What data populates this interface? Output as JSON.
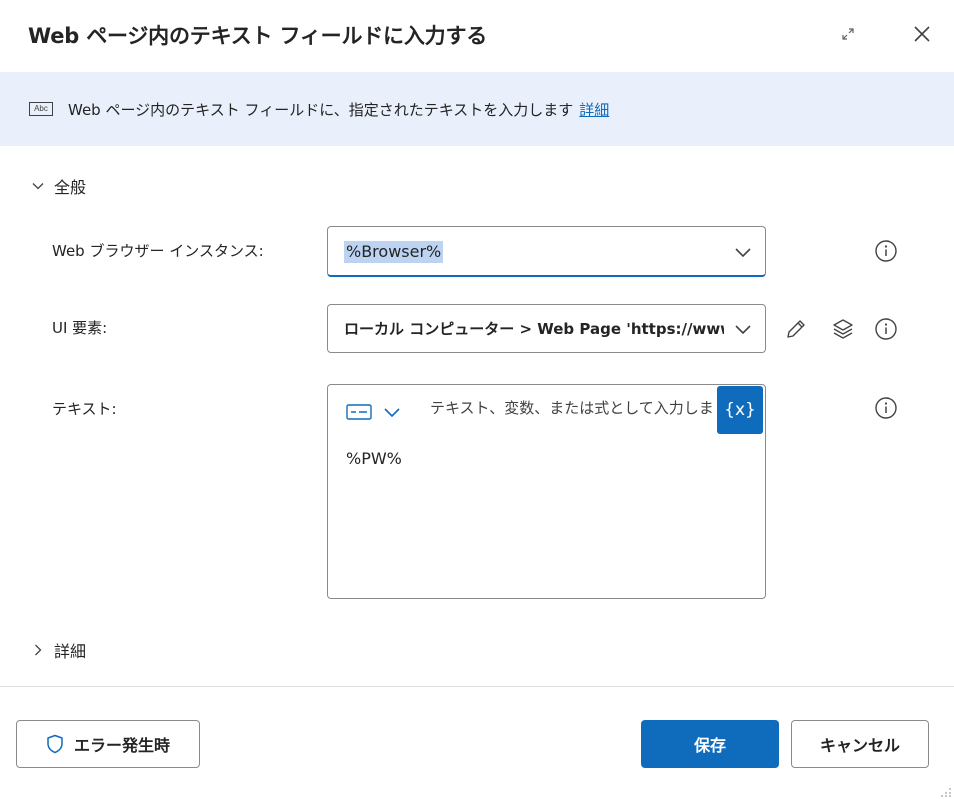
{
  "dialog": {
    "title": "Web ページ内のテキスト フィールドに入力する"
  },
  "info": {
    "description": "Web ページ内のテキスト フィールドに、指定されたテキストを入力します",
    "link_label": "詳細",
    "icon_text": "Abc"
  },
  "general_section": {
    "label": "全般",
    "expanded": true
  },
  "fields": {
    "browser": {
      "label": "Web ブラウザー インスタンス:",
      "value": "%Browser%"
    },
    "ui_element": {
      "label": "UI 要素:",
      "value": "ローカル コンピューター > Web Page 'https://www.."
    },
    "text": {
      "label": "テキスト:",
      "placeholder": "テキスト、変数、または式として入力しま",
      "variable_button": "{x}",
      "value": "%PW%"
    }
  },
  "advanced_section": {
    "label": "詳細",
    "expanded": false
  },
  "footer": {
    "on_error_label": "エラー発生時",
    "save_label": "保存",
    "cancel_label": "キャンセル"
  },
  "colors": {
    "accent": "#0f6cbd",
    "info_background": "#e9f0fb",
    "selection": "#bcd3f2"
  },
  "icons": [
    "expand-icon",
    "close-icon",
    "text-field-icon",
    "chevron-down-icon",
    "chevron-right-icon",
    "info-icon",
    "pencil-icon",
    "layers-icon",
    "text-mode-icon",
    "shield-icon",
    "resize-grip-icon"
  ]
}
